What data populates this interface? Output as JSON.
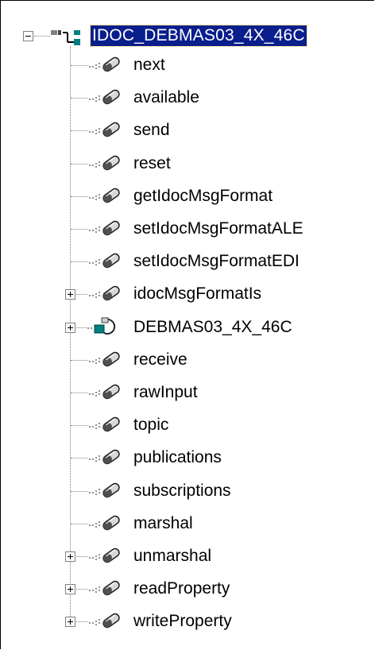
{
  "tree": {
    "root": {
      "label": "IDOC_DEBMAS03_4X_46C",
      "icon": "tree-root-icon",
      "selected": true,
      "expanded": true
    },
    "items": [
      {
        "label": "next",
        "icon": "method-icon",
        "expandable": false
      },
      {
        "label": "available",
        "icon": "method-icon",
        "expandable": false
      },
      {
        "label": "send",
        "icon": "method-icon",
        "expandable": false
      },
      {
        "label": "reset",
        "icon": "method-icon",
        "expandable": false
      },
      {
        "label": "getIdocMsgFormat",
        "icon": "method-icon",
        "expandable": false
      },
      {
        "label": "setIdocMsgFormatALE",
        "icon": "method-icon",
        "expandable": false
      },
      {
        "label": "setIdocMsgFormatEDI",
        "icon": "method-icon",
        "expandable": false
      },
      {
        "label": "idocMsgFormatIs",
        "icon": "method-icon",
        "expandable": true
      },
      {
        "label": "DEBMAS03_4X_46C",
        "icon": "idoc-structure-icon",
        "expandable": true
      },
      {
        "label": "receive",
        "icon": "method-icon",
        "expandable": false
      },
      {
        "label": "rawInput",
        "icon": "method-icon",
        "expandable": false
      },
      {
        "label": "topic",
        "icon": "method-icon",
        "expandable": false
      },
      {
        "label": "publications",
        "icon": "method-icon",
        "expandable": false
      },
      {
        "label": "subscriptions",
        "icon": "method-icon",
        "expandable": false
      },
      {
        "label": "marshal",
        "icon": "method-icon",
        "expandable": false
      },
      {
        "label": "unmarshal",
        "icon": "method-icon",
        "expandable": true
      },
      {
        "label": "readProperty",
        "icon": "method-icon",
        "expandable": true
      },
      {
        "label": "writeProperty",
        "icon": "method-icon",
        "expandable": true
      }
    ]
  },
  "colors": {
    "selection_bg": "#0a1e8c",
    "selection_text": "#ffffff",
    "tree_line": "#808080"
  }
}
